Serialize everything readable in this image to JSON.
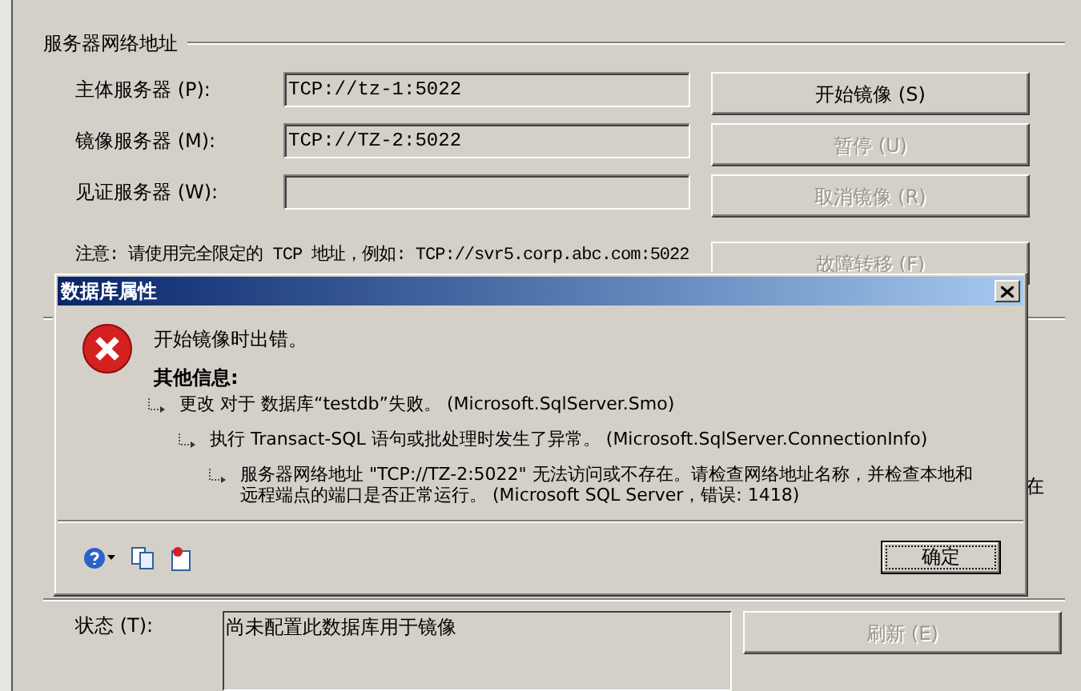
{
  "background_window": {
    "group_title": "服务器网络地址",
    "servers": [
      {
        "label": "主体服务器 (P):",
        "value": "TCP://tz-1:5022"
      },
      {
        "label": "镜像服务器 (M):",
        "value": "TCP://TZ-2:5022"
      },
      {
        "label": "见证服务器 (W):"
      }
    ],
    "buttons": [
      {
        "label": "开始镜像 (S)",
        "disabled": false
      },
      {
        "label": "暂停 (U)",
        "disabled": true
      },
      {
        "label": "取消镜像 (R)",
        "disabled": true
      },
      {
        "label": "故障转移 (F)",
        "disabled": true
      }
    ],
    "note": "注意: 请使用完全限定的 TCP 地址，例如: TCP://svr5.corp.abc.com:5022",
    "partial_text": "在",
    "status": {
      "label": "状态 (T):",
      "value": "尚未配置此数据库用于镜像"
    },
    "refresh_button": {
      "label": "刷新 (E)",
      "disabled": true
    }
  },
  "dialog": {
    "title": "数据库属性",
    "message": "开始镜像时出错。",
    "details_heading": "其他信息:",
    "details": [
      {
        "text": "更改 对于 数据库“testdb”失败。 (Microsoft.SqlServer.Smo)",
        "children": [
          {
            "text": "执行 Transact-SQL 语句或批处理时发生了异常。 (Microsoft.SqlServer.ConnectionInfo)",
            "children": [
              {
                "text": "服务器网络地址 \"TCP://TZ-2:5022\" 无法访问或不存在。请检查网络地址名称，并检查本地和远程端点的端口是否正常运行。 (Microsoft SQL Server，错误: 1418)"
              }
            ]
          }
        ]
      }
    ],
    "ok_button": "确定"
  }
}
